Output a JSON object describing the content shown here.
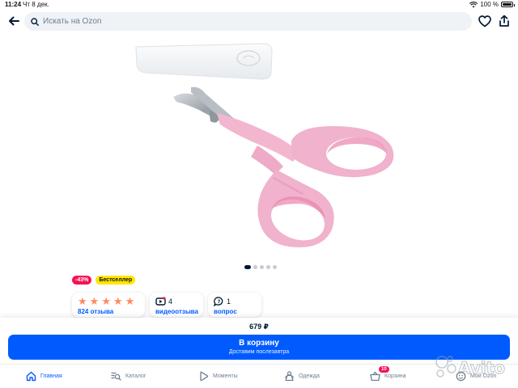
{
  "status_bar": {
    "time": "11:24",
    "date": "Чт 8 дек.",
    "battery": "100 %"
  },
  "header": {
    "search_placeholder": "Искать на Ozon",
    "icons": [
      "back-arrow-icon",
      "search-icon",
      "heart-icon",
      "share-icon"
    ]
  },
  "gallery": {
    "product": "pink-children-scissors-with-cap",
    "dots_total": 5,
    "active_dot": 1
  },
  "badges": {
    "discount": "-43%",
    "bestseller": "Бестселлер"
  },
  "stats": {
    "rating": 5,
    "reviews_link": "824 отзыва",
    "video_count": "4",
    "video_link": "видеоотзыва",
    "questions_count": "1",
    "questions_link": "вопрос"
  },
  "purchase": {
    "price": "679 ₽",
    "cart_button": "В корзину",
    "delivery": "Доставим послезавтра"
  },
  "tabbar": {
    "items": [
      {
        "label": "Главная",
        "icon": "home-icon",
        "active": true
      },
      {
        "label": "Каталог",
        "icon": "catalog-search-icon",
        "active": false
      },
      {
        "label": "Моменты",
        "icon": "play-icon",
        "active": false
      },
      {
        "label": "Одежда",
        "icon": "clothes-icon",
        "active": false
      },
      {
        "label": "Корзина",
        "icon": "basket-icon",
        "active": false,
        "badge": "10"
      },
      {
        "label": "Мой Ozon",
        "icon": "profile-icon",
        "active": false
      }
    ]
  },
  "colors": {
    "accent": "#005bff",
    "discount": "#f91155",
    "bestseller": "#ffe600",
    "star": "#ff8a5b",
    "scissors_pink": "#f2b6cf"
  },
  "watermark": "Avito"
}
